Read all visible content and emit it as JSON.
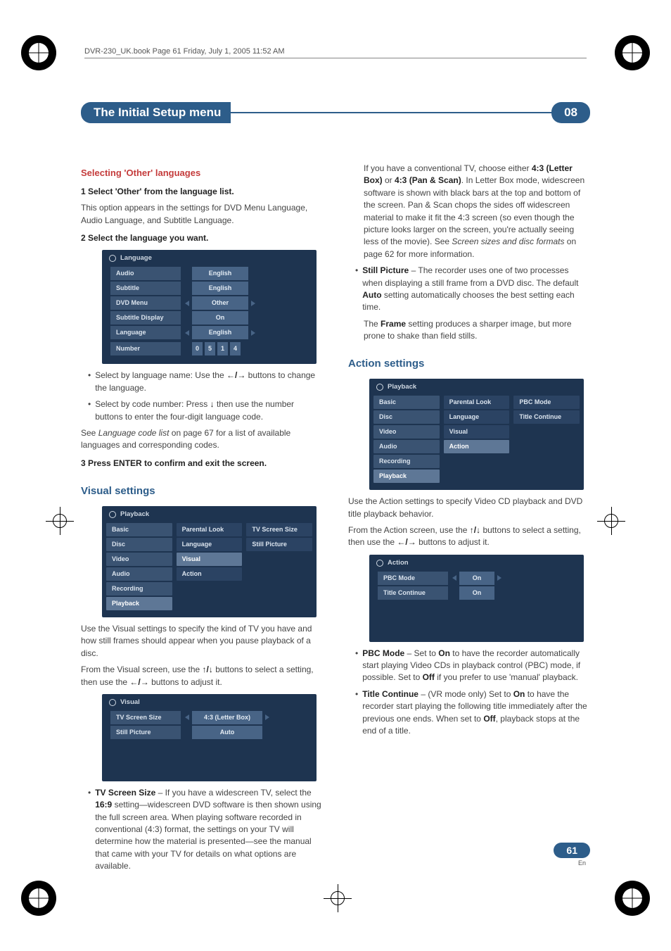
{
  "meta": {
    "header": "DVR-230_UK.book  Page 61  Friday, July 1, 2005  11:52 AM"
  },
  "titlebar": {
    "title": "The Initial Setup menu",
    "chapter": "08"
  },
  "left": {
    "h1": "Selecting 'Other' languages",
    "step1": "1    Select 'Other' from the language list.",
    "step1_body": "This option appears in the settings for DVD Menu Language, Audio Language, and Subtitle Language.",
    "step2": "2    Select the language you want.",
    "langMenu": {
      "title": "Language",
      "rows": [
        {
          "label": "Audio",
          "value": "English"
        },
        {
          "label": "Subtitle",
          "value": "English"
        },
        {
          "label": "DVD Menu",
          "value": "Other",
          "arrows": true
        },
        {
          "label": "Subtitle Display",
          "value": "On"
        },
        {
          "label": "Language",
          "value": "English",
          "arrows": true
        }
      ],
      "numberLabel": "Number",
      "numbers": [
        "0",
        "5",
        "1",
        "4"
      ]
    },
    "bullet1a": "Select by language name: Use the ",
    "bullet1b": " buttons to change the language.",
    "bullet2a": "Select by code number: Press ",
    "bullet2b": " then use the number buttons to enter the four-digit language code.",
    "seeLang": "See Language code list on page 67 for a list of available languages and corresponding codes.",
    "step3": "3    Press ENTER to confirm and exit the screen.",
    "h2": "Visual settings",
    "playbackMenu": {
      "title": "Playback",
      "left": [
        "Basic",
        "Disc",
        "Video",
        "Audio",
        "Recording",
        "Playback"
      ],
      "mid": [
        "Parental Look",
        "Language",
        "Visual",
        "Action"
      ],
      "right": [
        "TV Screen Size",
        "Still Picture"
      ]
    },
    "visualIntro": "Use the Visual settings to specify the kind of TV you have and how still frames should appear when you pause playback of a disc.",
    "visualFrom1": "From the Visual screen, use the ",
    "visualFrom2": " buttons to select a setting, then use the ",
    "visualFrom3": " buttons to adjust it.",
    "visualMenu": {
      "title": "Visual",
      "rows": [
        {
          "label": "TV Screen Size",
          "value": "4:3 (Letter Box)",
          "arrows": true
        },
        {
          "label": "Still Picture",
          "value": "Auto"
        }
      ]
    },
    "tvScreenBullet": "TV Screen Size – If you have a widescreen TV, select the 16:9 setting—widescreen DVD software is then shown using the full screen area. When playing software recorded in conventional (4:3) format, the settings on your TV will determine how the material is presented—see the manual that came with your TV for details on what options are available."
  },
  "right": {
    "tvConventional": "If you have a conventional TV, choose either 4:3 (Letter Box) or 4:3 (Pan & Scan). In Letter Box mode, widescreen software is shown with black bars at the top and bottom of the screen. Pan & Scan chops the sides off widescreen material to make it fit the 4:3 screen (so even though the picture looks larger on the screen, you're actually seeing less of the movie). See Screen sizes and disc formats on page 62 for more information.",
    "stillBullet": "Still Picture – The recorder uses one of two processes when displaying a still frame from a DVD disc. The default Auto setting automatically chooses the best setting each time.",
    "stillFrame": "The Frame setting produces a sharper image, but more prone to shake than field stills.",
    "h1": "Action settings",
    "playbackMenu": {
      "title": "Playback",
      "left": [
        "Basic",
        "Disc",
        "Video",
        "Audio",
        "Recording",
        "Playback"
      ],
      "mid": [
        "Parental Look",
        "Language",
        "Visual",
        "Action"
      ],
      "right": [
        "PBC Mode",
        "Title Continue"
      ]
    },
    "actionIntro": "Use the Action settings to specify Video CD playback and DVD title playback behavior.",
    "actionFrom1": "From the Action screen, use the ",
    "actionFrom2": " buttons to select a setting, then use the ",
    "actionFrom3": " buttons to adjust it.",
    "actionMenu": {
      "title": "Action",
      "rows": [
        {
          "label": "PBC Mode",
          "value": "On",
          "arrows": true
        },
        {
          "label": "Title Continue",
          "value": "On"
        }
      ]
    },
    "pbcBullet": "PBC Mode – Set to On to have the recorder automatically start playing Video CDs in playback control (PBC) mode, if possible. Set to Off if you prefer to use 'manual' playback.",
    "titleContBullet": "Title Continue – (VR mode only) Set to On to have the recorder start playing the following title immediately after the previous one ends. When set to Off, playback stops at the end of a title."
  },
  "footer": {
    "page": "61",
    "lang": "En"
  },
  "glyphs": {
    "leftRight": "←/→",
    "down": "↓",
    "upDown": "↑/↓"
  }
}
